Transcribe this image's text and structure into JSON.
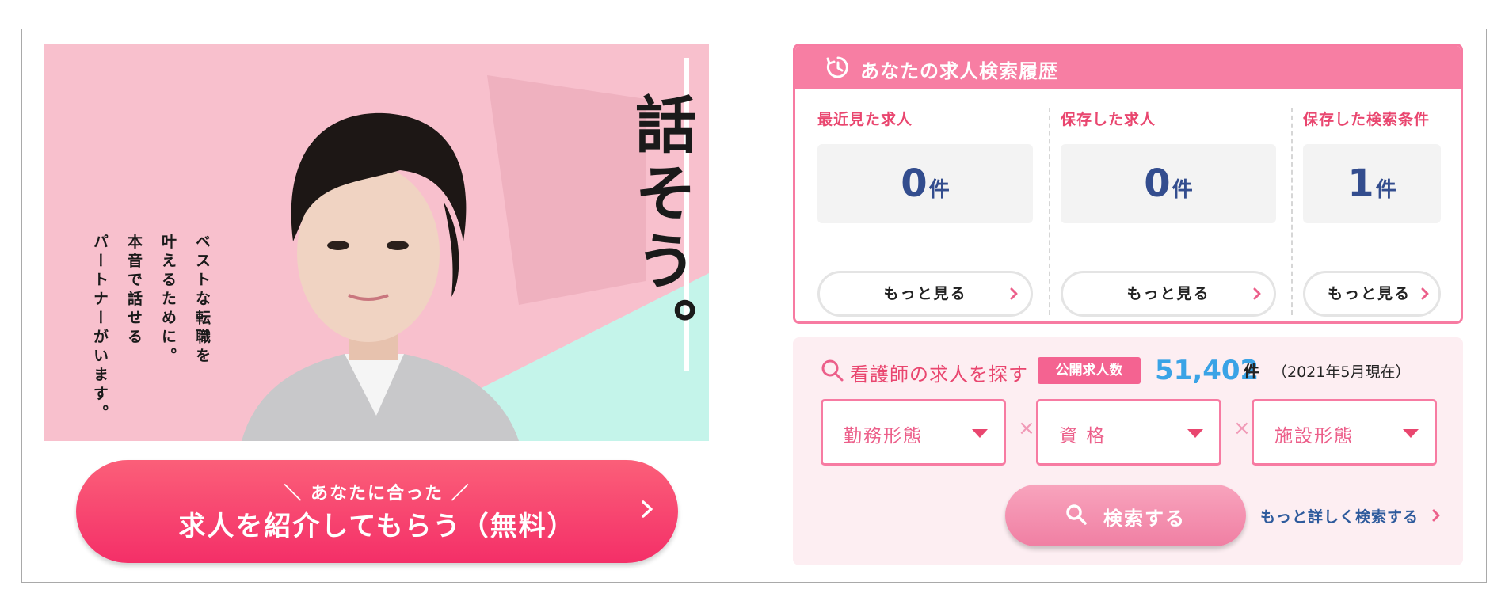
{
  "hero": {
    "headline": "話そう。",
    "copy_lines": [
      "ベストな転職を",
      "叶えるために。",
      "本音で話せる",
      "パートナーがいます。"
    ]
  },
  "cta": {
    "sub_label": "＼ あなたに合った ／",
    "main_label": "求人を紹介してもらう（無料）"
  },
  "history": {
    "title": "あなたの求人検索履歴",
    "columns": [
      {
        "label": "最近見た求人",
        "count": "0",
        "unit": "件",
        "more_label": "もっと見る"
      },
      {
        "label": "保存した求人",
        "count": "0",
        "unit": "件",
        "more_label": "もっと見る"
      },
      {
        "label": "保存した検索条件",
        "count": "1",
        "unit": "件",
        "more_label": "もっと見る"
      }
    ]
  },
  "search": {
    "title": "看護師の求人を探す",
    "badge": "公開求人数",
    "total": "51,402",
    "total_unit": "件",
    "as_of": "（2021年5月現在）",
    "selects": [
      {
        "label": "勤務形態"
      },
      {
        "label": "資 格"
      },
      {
        "label": "施設形態"
      }
    ],
    "separator": "×",
    "submit_label": "検索する",
    "detail_link": "もっと詳しく検索する"
  },
  "colors": {
    "accent_pink": "#f77ea3",
    "cta_red": "#f42f68",
    "count_navy": "#334d8e",
    "total_blue": "#3aa3e6"
  }
}
